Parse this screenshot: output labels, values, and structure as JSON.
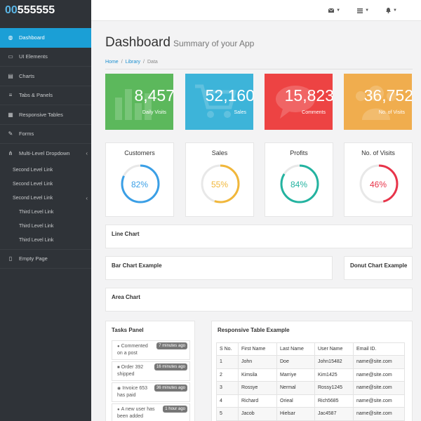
{
  "brand": {
    "prefix": "00",
    "suffix": "555555"
  },
  "topbar": {
    "icons": [
      "envelope-icon",
      "tasks-icon",
      "bell-icon"
    ]
  },
  "sidebar": {
    "items": [
      {
        "label": "Dashboard",
        "icon": "dashboard-icon"
      },
      {
        "label": "UI Elements",
        "icon": "desktop-icon"
      },
      {
        "label": "Charts",
        "icon": "chart-icon"
      },
      {
        "label": "Tabs & Panels",
        "icon": "bars-icon"
      },
      {
        "label": "Responsive Tables",
        "icon": "table-icon"
      },
      {
        "label": "Forms",
        "icon": "edit-icon"
      },
      {
        "label": "Multi-Level Dropdown",
        "icon": "sitemap-icon"
      }
    ],
    "second_level": [
      "Second Level Link",
      "Second Level Link",
      "Second Level Link"
    ],
    "third_level": [
      "Third Level Link",
      "Third Level Link",
      "Third Level Link"
    ],
    "empty_page": "Empty Page"
  },
  "header": {
    "title": "Dashboard",
    "subtitle": "Summary of your App"
  },
  "breadcrumb": {
    "home": "Home",
    "library": "Library",
    "current": "Data"
  },
  "stats": [
    {
      "value": "8,457",
      "label": "Daily Visits",
      "color": "#5cb85c"
    },
    {
      "value": "52,160",
      "label": "Sales",
      "color": "#3db4d9"
    },
    {
      "value": "15,823",
      "label": "Comments",
      "color": "#ed4343"
    },
    {
      "value": "36,752",
      "label": "No. of Visits",
      "color": "#f0ad4e"
    }
  ],
  "gauges": [
    {
      "title": "Customers",
      "percent": 82,
      "label": "82%",
      "color": "#3a9fe6"
    },
    {
      "title": "Sales",
      "percent": 55,
      "label": "55%",
      "color": "#f1b73a"
    },
    {
      "title": "Profits",
      "percent": 84,
      "label": "84%",
      "color": "#23b3a0"
    },
    {
      "title": "No. of Visits",
      "percent": 46,
      "label": "46%",
      "color": "#e8344a"
    }
  ],
  "panels": {
    "line_chart": "Line Chart",
    "bar_chart": "Bar Chart Example",
    "donut_chart": "Donut Chart Example",
    "area_chart": "Area Chart",
    "tasks": "Tasks Panel",
    "table": "Responsive Table Example"
  },
  "tasks": [
    {
      "text1": "Commented",
      "text2": "on a post",
      "badge": "7 minutes ago",
      "icon": "comment-icon"
    },
    {
      "text1": "Order 392",
      "text2": "shipped",
      "badge": "16 minutes ago",
      "icon": "truck-icon"
    },
    {
      "text1": "Invoice 653",
      "text2": "has paid",
      "badge": "36 minutes ago",
      "icon": "globe-icon"
    },
    {
      "text1": "A new user has",
      "text2": "been added",
      "badge": "1 hour ago",
      "icon": "user-icon"
    }
  ],
  "table": {
    "headers": [
      "S No.",
      "First Name",
      "Last Name",
      "User Name",
      "Email ID."
    ],
    "rows": [
      [
        "1",
        "John",
        "Doe",
        "John15482",
        "name@site.com"
      ],
      [
        "2",
        "Kimsila",
        "Marriye",
        "Kim1425",
        "name@site.com"
      ],
      [
        "3",
        "Rossye",
        "Nermal",
        "Rossy1245",
        "name@site.com"
      ],
      [
        "4",
        "Richard",
        "Orieal",
        "Rich5685",
        "name@site.com"
      ],
      [
        "5",
        "Jacob",
        "Hielsar",
        "Jac4587",
        "name@site.com"
      ]
    ]
  }
}
